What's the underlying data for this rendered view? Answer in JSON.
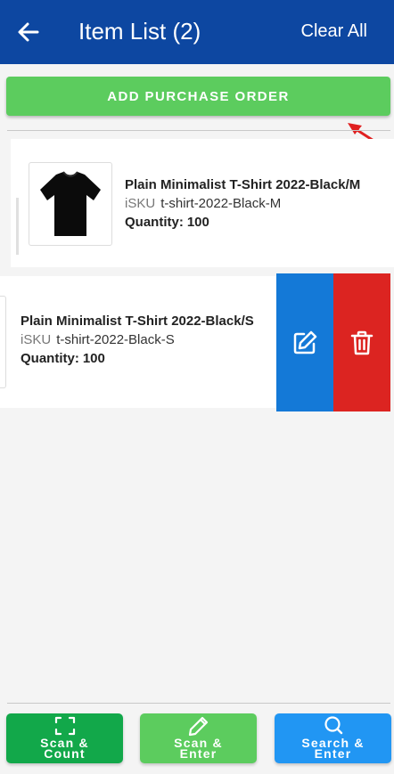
{
  "header": {
    "title": "Item List (2)",
    "clear_label": "Clear All",
    "back_icon": "arrow-left-icon"
  },
  "actions": {
    "add_po_label": "ADD PURCHASE ORDER"
  },
  "items": [
    {
      "name": "Plain Minimalist T-Shirt 2022-Black/M",
      "sku_label": "iSKU",
      "sku": "t-shirt-2022-Black-M",
      "qty_label": "Quantity:",
      "qty": "100",
      "image": "black-tshirt"
    },
    {
      "name": "Plain Minimalist T-Shirt 2022-Black/S",
      "sku_label": "iSKU",
      "sku": "t-shirt-2022-Black-S",
      "qty_label": "Quantity:",
      "qty": "100",
      "swipe_actions": [
        "edit-icon",
        "trash-icon"
      ]
    }
  ],
  "bottom_buttons": [
    {
      "label": "Scan &\nCount",
      "icon": "scan-frame-icon",
      "color": "#12a84a"
    },
    {
      "label": "Scan &\nEnter",
      "icon": "pencil-icon",
      "color": "#5ccc5e"
    },
    {
      "label": "Search &\nEnter",
      "icon": "search-icon",
      "color": "#2196f3"
    }
  ],
  "colors": {
    "header": "#0d47a1",
    "green": "#5ccc5e",
    "edit": "#1479d7",
    "delete": "#dc2421",
    "annotation_arrow": "#e02020"
  }
}
